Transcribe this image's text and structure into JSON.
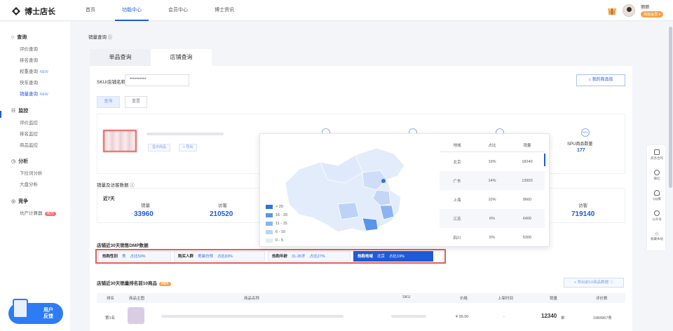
{
  "app": {
    "name": "博士店长"
  },
  "nav": {
    "items": [
      "首页",
      "功能中心",
      "会员中心",
      "博士资讯"
    ],
    "active": "功能中心"
  },
  "user": {
    "name": "丽丽",
    "badge": "高级会员 ▾"
  },
  "sidebar": {
    "groups": [
      {
        "title": "查询",
        "items": [
          {
            "label": "评价查询",
            "tag": ""
          },
          {
            "label": "排名查询",
            "tag": ""
          },
          {
            "label": "权重查询",
            "tag": "NEW"
          },
          {
            "label": "快车查询",
            "tag": ""
          },
          {
            "label": "销量查询",
            "tag": "NEW"
          }
        ]
      },
      {
        "title": "监控",
        "items": [
          {
            "label": "评价监控",
            "tag": ""
          },
          {
            "label": "排名监控",
            "tag": ""
          },
          {
            "label": "商品监控",
            "tag": ""
          }
        ]
      },
      {
        "title": "分析",
        "items": [
          {
            "label": "下拉词分析",
            "tag": ""
          },
          {
            "label": "大盘分析",
            "tag": ""
          }
        ]
      },
      {
        "title": "竞争",
        "items": [
          {
            "label": "坑产计算器",
            "tag": "HOT"
          }
        ]
      }
    ],
    "feedback": [
      "用户",
      "反馈"
    ]
  },
  "main": {
    "breadcrumb": "销量查询 ⓘ",
    "tabs": [
      "单品查询",
      "店铺查询"
    ],
    "active_tab": "店铺查询",
    "search_label": "SKU/店铺名称",
    "search_value": "**********",
    "query_btn": "查询",
    "reset_btn": "重置",
    "my_library_btn": "我的商品库",
    "product_btns": [
      "显示商品",
      "+ 导出"
    ],
    "spu_label": "SPU商品数量",
    "spu_value": "177",
    "section_sales": "销量及访客数据 ⓘ",
    "period": "近7天",
    "stats": [
      {
        "label": "销量",
        "value": "33960"
      },
      {
        "label": "访客",
        "value": "210520"
      },
      {
        "label": "访客",
        "value": "719140"
      }
    ],
    "dmp_title": "店铺近30天销售DMP数据",
    "dmp_tags": [
      {
        "k": "热购性别",
        "v": "男",
        "p": "占比50%"
      },
      {
        "k": "购买人群",
        "v": "男装白领",
        "p": "占比83%"
      },
      {
        "k": "热购年龄",
        "v": "31-35岁",
        "p": "占比27%"
      },
      {
        "k": "热购地域",
        "v": "北京",
        "p": "占比19%"
      }
    ],
    "top10_title": "店铺近30天销量排名前10商品",
    "export_btn": "+ 导出前10商品数据 ⓘ",
    "table_headers": [
      "排名",
      "商品主图",
      "商品名称",
      "SKU",
      "价格",
      "上架时间",
      "销量",
      "评价数"
    ],
    "row1": {
      "rank": "第1名",
      "price": "¥ 99.00",
      "date": "-",
      "sales": "12340",
      "sales_unit": "单",
      "reviews": "1984967条"
    }
  },
  "popup": {
    "legend": [
      "> 20",
      "16 - 20",
      "11 - 15",
      "6 - 10",
      "0 - 5"
    ],
    "legend_colors": [
      "#2f74e0",
      "#5a93ea",
      "#8cb3f1",
      "#bcd3f7",
      "#e2ecfb"
    ],
    "headers": [
      "地域",
      "占比",
      "销量"
    ],
    "rows": [
      [
        "北京",
        "19%",
        "18240"
      ],
      [
        "广东",
        "14%",
        "13920"
      ],
      [
        "上海",
        "10%",
        "9660"
      ],
      [
        "江苏",
        "6%",
        "6400"
      ],
      [
        "四川",
        "5%",
        "5300"
      ]
    ]
  },
  "rightbar": [
    "商务合作",
    "微信",
    "QQ群",
    "公众号",
    "收藏本站"
  ]
}
